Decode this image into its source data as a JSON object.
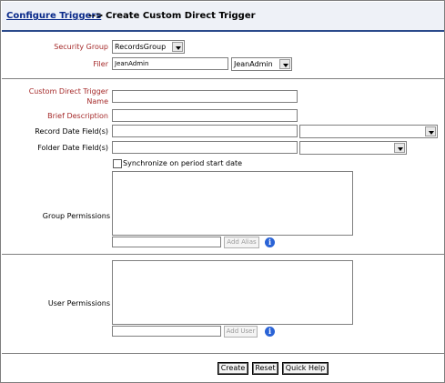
{
  "header": {
    "breadcrumb_link": "Configure Triggers",
    "separator": "-->",
    "title": "Create Custom Direct Trigger"
  },
  "form": {
    "security_group": {
      "label": "Security Group",
      "value": "RecordsGroup"
    },
    "filer": {
      "label": "Filer",
      "input_value": "JeanAdmin",
      "select_value": "JeanAdmin"
    },
    "trigger_name": {
      "label_line1": "Custom Direct Trigger",
      "label_line2": "Name",
      "value": ""
    },
    "brief_description": {
      "label": "Brief Description",
      "value": ""
    },
    "record_date": {
      "label": "Record Date Field(s)",
      "value": "",
      "select_value": ""
    },
    "folder_date": {
      "label": "Folder Date Field(s)",
      "value": "",
      "select_value": ""
    },
    "sync_checkbox": {
      "label": "Synchronize on period start date",
      "checked": false
    },
    "group_permissions": {
      "label": "Group Permissions",
      "add_label": "Add Alias"
    },
    "user_permissions": {
      "label": "User Permissions",
      "add_label": "Add User"
    }
  },
  "buttons": {
    "create": "Create",
    "reset": "Reset",
    "quick_help": "Quick Help"
  },
  "icons": {
    "info": "i"
  },
  "colors": {
    "required_label": "#a52a2a",
    "link": "#0a2a8a",
    "info_icon": "#2a63d6"
  }
}
